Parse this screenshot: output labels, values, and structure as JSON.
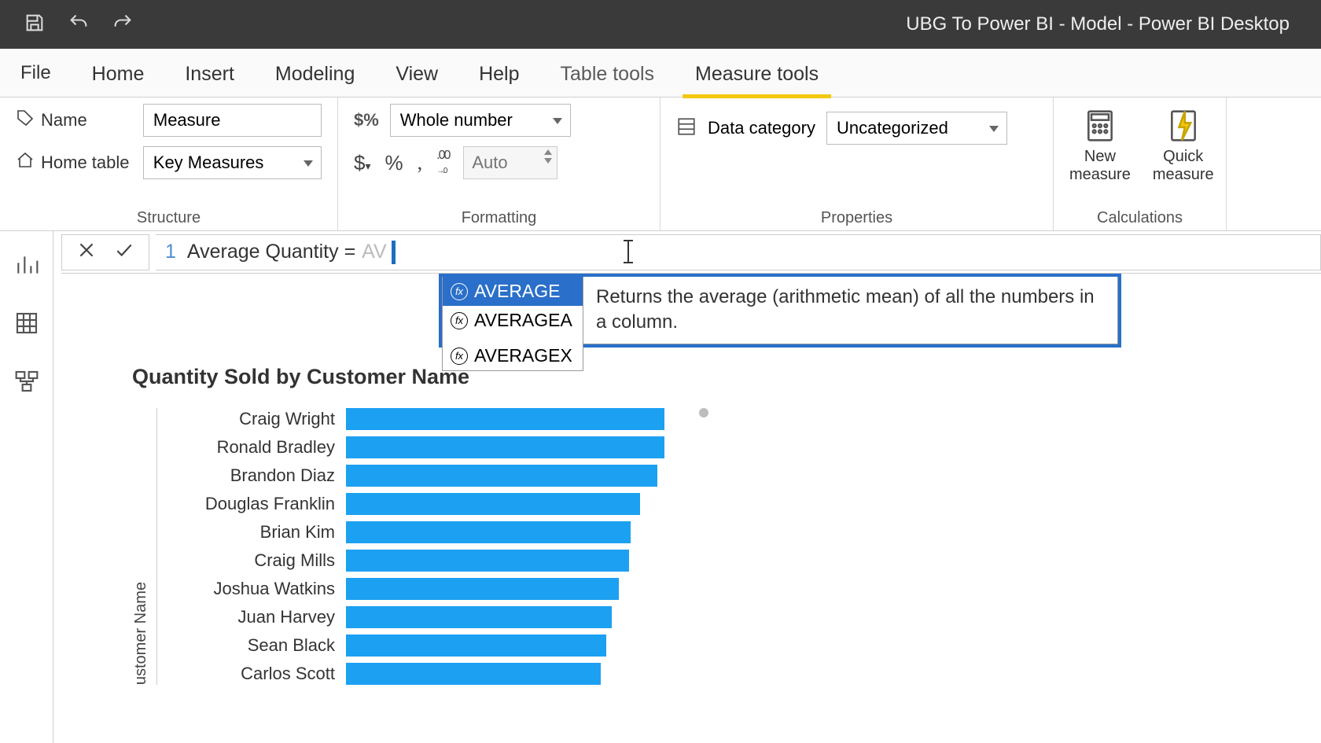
{
  "app": {
    "title": "UBG To Power BI - Model - Power BI Desktop"
  },
  "menu": {
    "file": "File",
    "home": "Home",
    "insert": "Insert",
    "modeling": "Modeling",
    "view": "View",
    "help": "Help",
    "table_tools": "Table tools",
    "measure_tools": "Measure tools"
  },
  "ribbon": {
    "structure": {
      "label": "Structure",
      "name_label": "Name",
      "name_value": "Measure",
      "home_table_label": "Home table",
      "home_table_value": "Key Measures"
    },
    "formatting": {
      "label": "Formatting",
      "data_type": "Whole number",
      "decimals_placeholder": "Auto"
    },
    "properties": {
      "label": "Properties",
      "data_category_label": "Data category",
      "data_category_value": "Uncategorized"
    },
    "calculations": {
      "label": "Calculations",
      "new_measure": "New measure",
      "quick_measure": "Quick measure"
    }
  },
  "formula": {
    "line_number": "1",
    "text": "Average Quantity ="
  },
  "intellisense": {
    "items": [
      {
        "name": "AVERAGE",
        "selected": true
      },
      {
        "name": "AVERAGEA",
        "selected": false
      },
      {
        "name": "AVERAGEX",
        "selected": false
      }
    ],
    "description": "Returns the average (arithmetic mean) of all the numbers in a column."
  },
  "chart_data": {
    "type": "bar",
    "title": "Quantity Sold by Customer Name",
    "ylabel": "ustomer Name",
    "categories": [
      "Craig Wright",
      "Ronald Bradley",
      "Brandon Diaz",
      "Douglas Franklin",
      "Brian Kim",
      "Craig Mills",
      "Joshua Watkins",
      "Juan Harvey",
      "Sean Black",
      "Carlos Scott"
    ],
    "values": [
      450,
      450,
      440,
      415,
      402,
      400,
      385,
      375,
      368,
      360
    ],
    "xlim": [
      0,
      500
    ]
  }
}
